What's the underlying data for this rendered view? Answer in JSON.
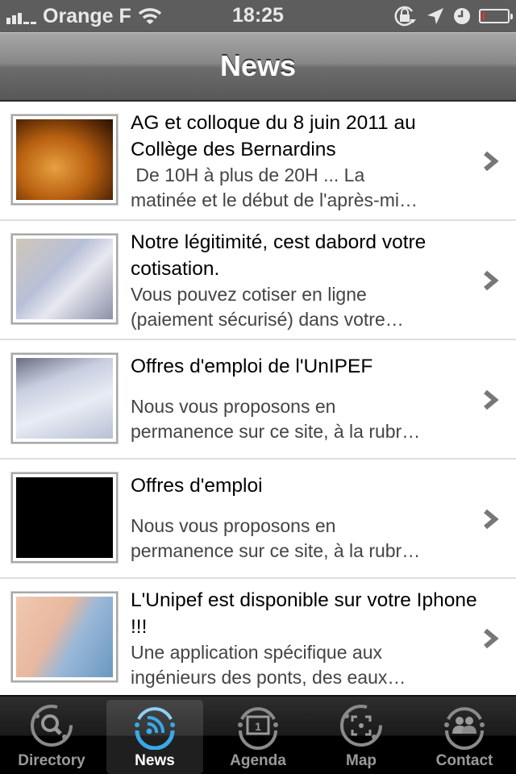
{
  "status_bar": {
    "carrier": "Orange F",
    "time": "18:25",
    "signal_bars_filled": 3,
    "signal_bars_total": 5,
    "battery_level": 0.1,
    "icons": [
      "signal-icon",
      "wifi-icon",
      "rotation-lock-icon",
      "location-icon",
      "alarm-icon",
      "battery-icon"
    ],
    "battery_color": "#d43a2a"
  },
  "nav_bar": {
    "title": "News"
  },
  "news": [
    {
      "title": "AG et colloque du 8 juin 2011 au Collège des Bernardins",
      "desc_line1": " De 10H à plus de 20H ... La",
      "desc_line2": "matinée et le début de l'après-mi…",
      "thumbnail": "college-bernardins-photo"
    },
    {
      "title": "Notre légitimité, cest dabord votre cotisation.",
      "desc_line1": "Vous pouvez cotiser en ligne",
      "desc_line2": "(paiement sécurisé) dans votre…",
      "thumbnail": "euro-banknotes-photo"
    },
    {
      "title": "Offres d'emploi de l'UnIPEF",
      "desc_line1": "Nous vous proposons en",
      "desc_line2": "permanence sur ce site, à la rubr…",
      "thumbnail": "pen-document-photo"
    },
    {
      "title": "Offres d'emploi",
      "desc_line1": "Nous vous proposons en",
      "desc_line2": "permanence sur ce site, à la rubr…",
      "thumbnail": "black-placeholder"
    },
    {
      "title": "L'Unipef est disponible sur votre Iphone !!!",
      "desc_line1": "Une application spécifique aux",
      "desc_line2": "ingénieurs des ponts, des eaux…",
      "thumbnail": "hand-holding-iphone-photo"
    }
  ],
  "tab_bar": {
    "active": "News",
    "accent_color": "#3aa8e8",
    "tabs": [
      {
        "label": "Directory",
        "icon": "directory-search-icon"
      },
      {
        "label": "News",
        "icon": "news-rss-icon"
      },
      {
        "label": "Agenda",
        "icon": "agenda-calendar-icon"
      },
      {
        "label": "Map",
        "icon": "map-target-icon"
      },
      {
        "label": "Contact",
        "icon": "contact-people-icon"
      }
    ]
  }
}
